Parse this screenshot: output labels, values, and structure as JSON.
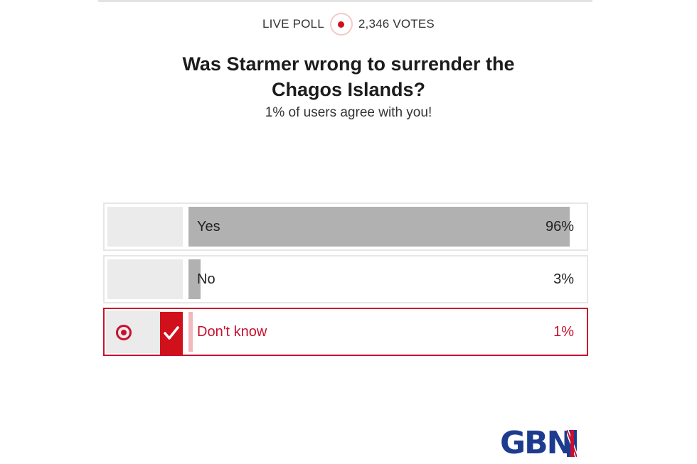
{
  "header": {
    "live_label": "LIVE POLL",
    "votes_label": "2,346 VOTES"
  },
  "poll": {
    "question": "Was Starmer wrong to surrender the Chagos Islands?",
    "result_message": "1% of users agree with you!",
    "options": [
      {
        "label": "Yes",
        "percent_label": "96%",
        "percent": 96,
        "selected": false
      },
      {
        "label": "No",
        "percent_label": "3%",
        "percent": 3,
        "selected": false
      },
      {
        "label": "Don't know",
        "percent_label": "1%",
        "percent": 1,
        "selected": true
      }
    ]
  },
  "brand": {
    "logo_text": "GBN",
    "primary_color": "#1d3c8f",
    "accent_color": "#c8102e"
  },
  "icons": {
    "live": "live-dot-icon",
    "selected_radio": "radio-selected-icon",
    "check": "checkmark-icon"
  }
}
